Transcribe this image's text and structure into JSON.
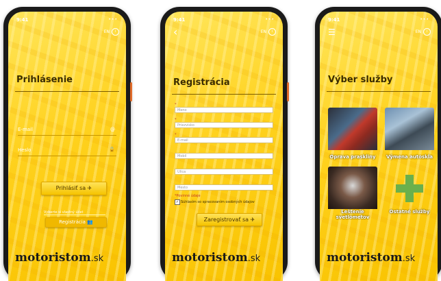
{
  "status": {
    "time": "9:41",
    "sys": "•••"
  },
  "lang": {
    "code": "EN",
    "info": "i"
  },
  "login": {
    "title": "Prihlásenie",
    "email_label": "E-mail",
    "email_icon": "@",
    "password_label": "Heslo",
    "password_icon": "🔒",
    "login_button": "Prihlásiť sa ✈",
    "choose_text": "Vyberte si vlastný účet",
    "register_button": "Registrácia 👥"
  },
  "register": {
    "back_icon": "‹",
    "title": "Registrácia",
    "fields": [
      "Meno",
      "Priezvisko",
      "E-mail",
      "Mobil",
      "Ulica",
      "Mesto"
    ],
    "required_note": "*Povinné údaje",
    "consent": "Súhlasím so spracovaním osobných údajov",
    "submit_button": "Zaregistrovať sa ✈"
  },
  "services": {
    "menu_icon": "☰",
    "title": "Výber služby",
    "items": [
      "Oprava praskliny",
      "Výmena autoskla",
      "Leštenie svetlometov",
      "Ostatné služby"
    ]
  },
  "brand": {
    "name": "motoristom",
    "tld": ".sk"
  },
  "colors": {
    "yellow": "#ffd21f",
    "dark": "#1a1a1a",
    "plus": "#6ab04c"
  }
}
